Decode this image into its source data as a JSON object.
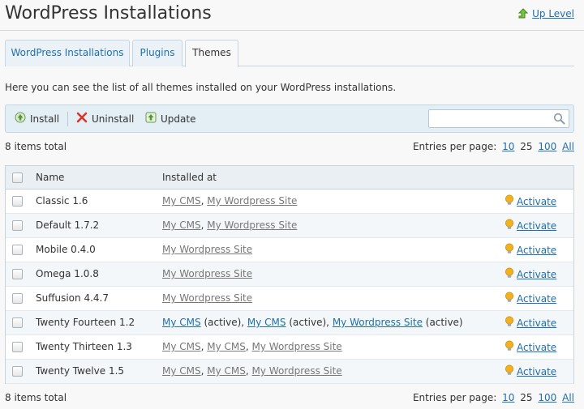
{
  "header": {
    "title": "WordPress Installations",
    "up_level": "Up Level"
  },
  "tabs": [
    {
      "label": "WordPress Installations",
      "active": false
    },
    {
      "label": "Plugins",
      "active": false
    },
    {
      "label": "Themes",
      "active": true
    }
  ],
  "intro": "Here you can see the list of all themes installed on your WordPress installations.",
  "toolbar": {
    "install": "Install",
    "uninstall": "Uninstall",
    "update": "Update",
    "search_value": ""
  },
  "pagination": {
    "total": "8 items total",
    "entries_label": "Entries per page:",
    "opt_10": "10",
    "opt_25": "25",
    "opt_100": "100",
    "opt_all": "All"
  },
  "table": {
    "col_name": "Name",
    "col_installed": "Installed at",
    "rows": [
      {
        "name": "Classic 1.6",
        "sites": [
          {
            "text": "My CMS",
            "suffix": ", "
          },
          {
            "text": "My Wordpress Site",
            "suffix": ""
          }
        ],
        "action": "Activate"
      },
      {
        "name": "Default 1.7.2",
        "sites": [
          {
            "text": "My CMS",
            "suffix": ", "
          },
          {
            "text": "My Wordpress Site",
            "suffix": ""
          }
        ],
        "action": "Activate"
      },
      {
        "name": "Mobile 0.4.0",
        "sites": [
          {
            "text": "My Wordpress Site",
            "suffix": ""
          }
        ],
        "action": "Activate"
      },
      {
        "name": "Omega 1.0.8",
        "sites": [
          {
            "text": "My Wordpress Site",
            "suffix": ""
          }
        ],
        "action": "Activate"
      },
      {
        "name": "Suffusion 4.4.7",
        "sites": [
          {
            "text": "My Wordpress Site",
            "suffix": ""
          }
        ],
        "action": "Activate"
      },
      {
        "name": "Twenty Fourteen 1.2",
        "sites": [
          {
            "text": "My CMS",
            "suffix": " (active), ",
            "active": true
          },
          {
            "text": "My CMS",
            "suffix": " (active), ",
            "active": true
          },
          {
            "text": "My Wordpress Site",
            "suffix": " (active)",
            "active": true
          }
        ],
        "action": "Activate"
      },
      {
        "name": "Twenty Thirteen 1.3",
        "sites": [
          {
            "text": "My CMS",
            "suffix": ", "
          },
          {
            "text": "My CMS",
            "suffix": ", "
          },
          {
            "text": "My Wordpress Site",
            "suffix": ""
          }
        ],
        "action": "Activate"
      },
      {
        "name": "Twenty Twelve 1.5",
        "sites": [
          {
            "text": "My CMS",
            "suffix": ", "
          },
          {
            "text": "My CMS",
            "suffix": ", "
          },
          {
            "text": "My Wordpress Site",
            "suffix": ""
          }
        ],
        "action": "Activate"
      }
    ]
  },
  "icons": {
    "up_level": "up-arrow-icon",
    "install": "install-icon",
    "uninstall": "red-x-icon",
    "update": "update-icon",
    "search": "magnifier-icon",
    "activate": "lightbulb-icon"
  },
  "colors": {
    "link": "#1f6fa9",
    "gray_link": "#777777",
    "toolbar_bg": "#e4eef5",
    "tab_bg": "#eaf2f7",
    "bulb": "#f3b21b"
  }
}
